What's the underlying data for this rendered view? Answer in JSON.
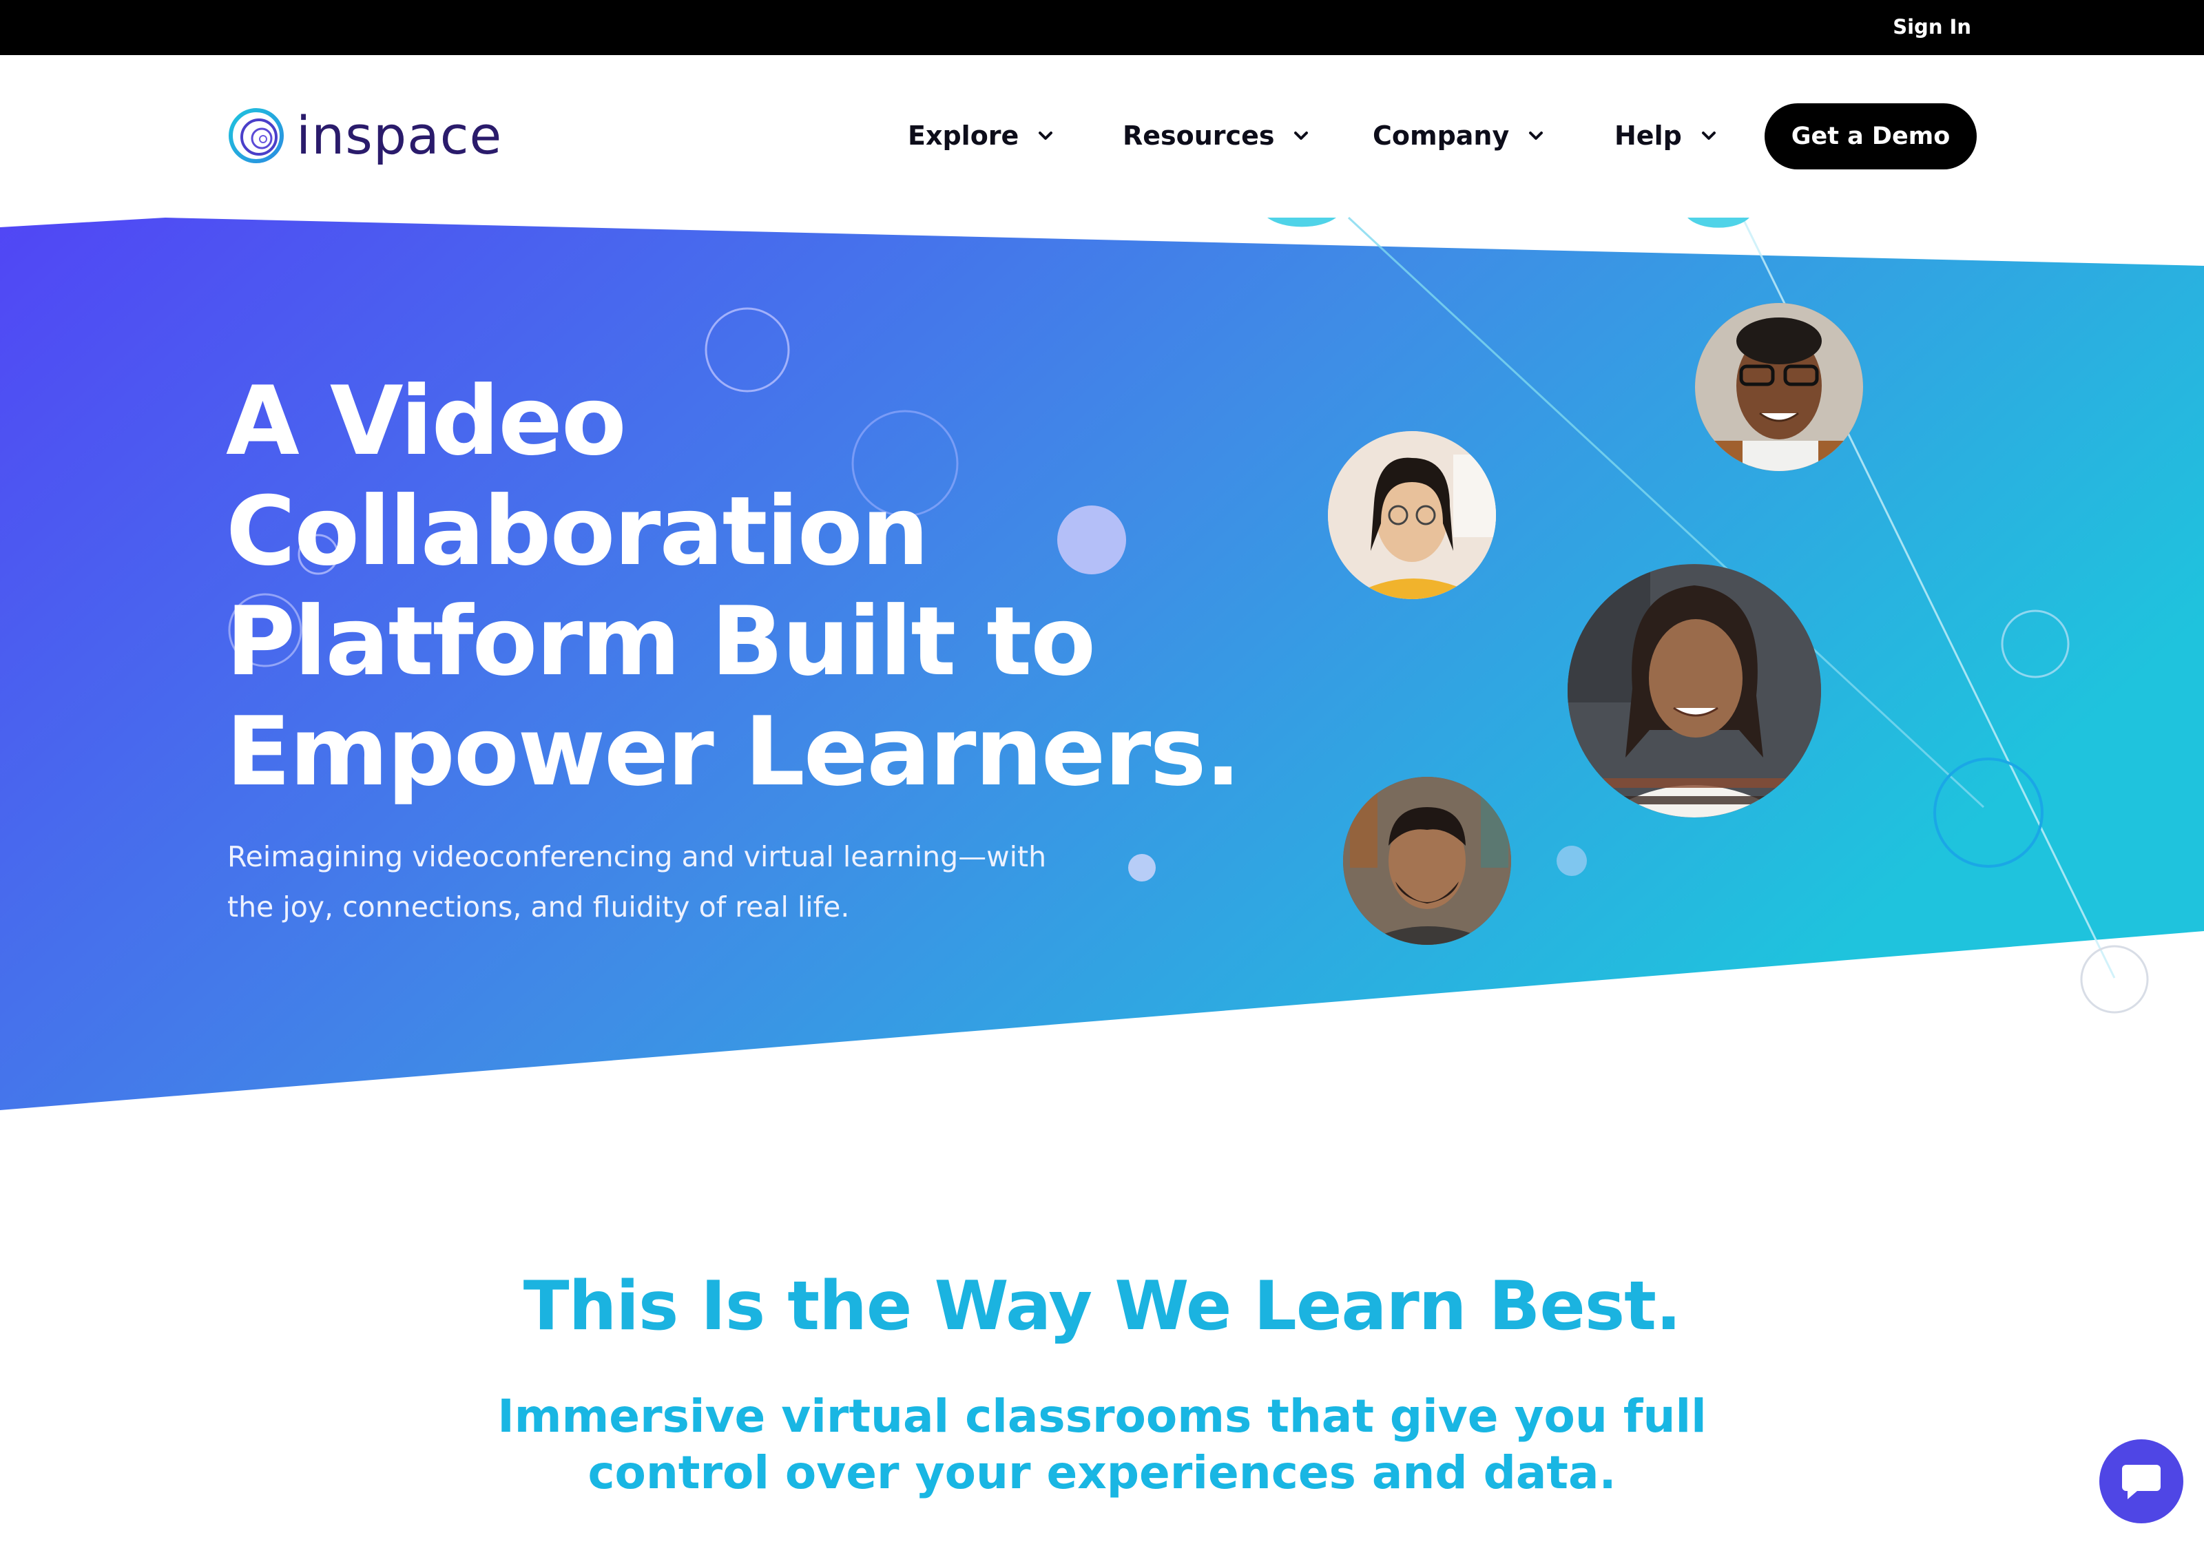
{
  "topbar": {
    "signin_label": "Sign In"
  },
  "header": {
    "logo_text": "inspace",
    "nav": [
      {
        "label": "Explore"
      },
      {
        "label": "Resources"
      },
      {
        "label": "Company"
      },
      {
        "label": "Help"
      }
    ],
    "cta_label": "Get a Demo"
  },
  "hero": {
    "headline_lines": [
      "A Video",
      "Collaboration",
      "Platform Built to",
      "Empower Learners."
    ],
    "subtext": "Reimagining videoconferencing and virtual learning—with the joy, connections, and fluidity of real life.",
    "gradient_start": "#5146f5",
    "gradient_end": "#1fc3dd"
  },
  "section": {
    "title": "This Is the Way We Learn Best.",
    "subtitle": "Immersive virtual classrooms that give you full control over your experiences and data."
  },
  "icons": {
    "logo": "inspace-swirl-logo-icon",
    "chevron": "chevron-down-icon",
    "chat": "chat-bubble-icon"
  }
}
